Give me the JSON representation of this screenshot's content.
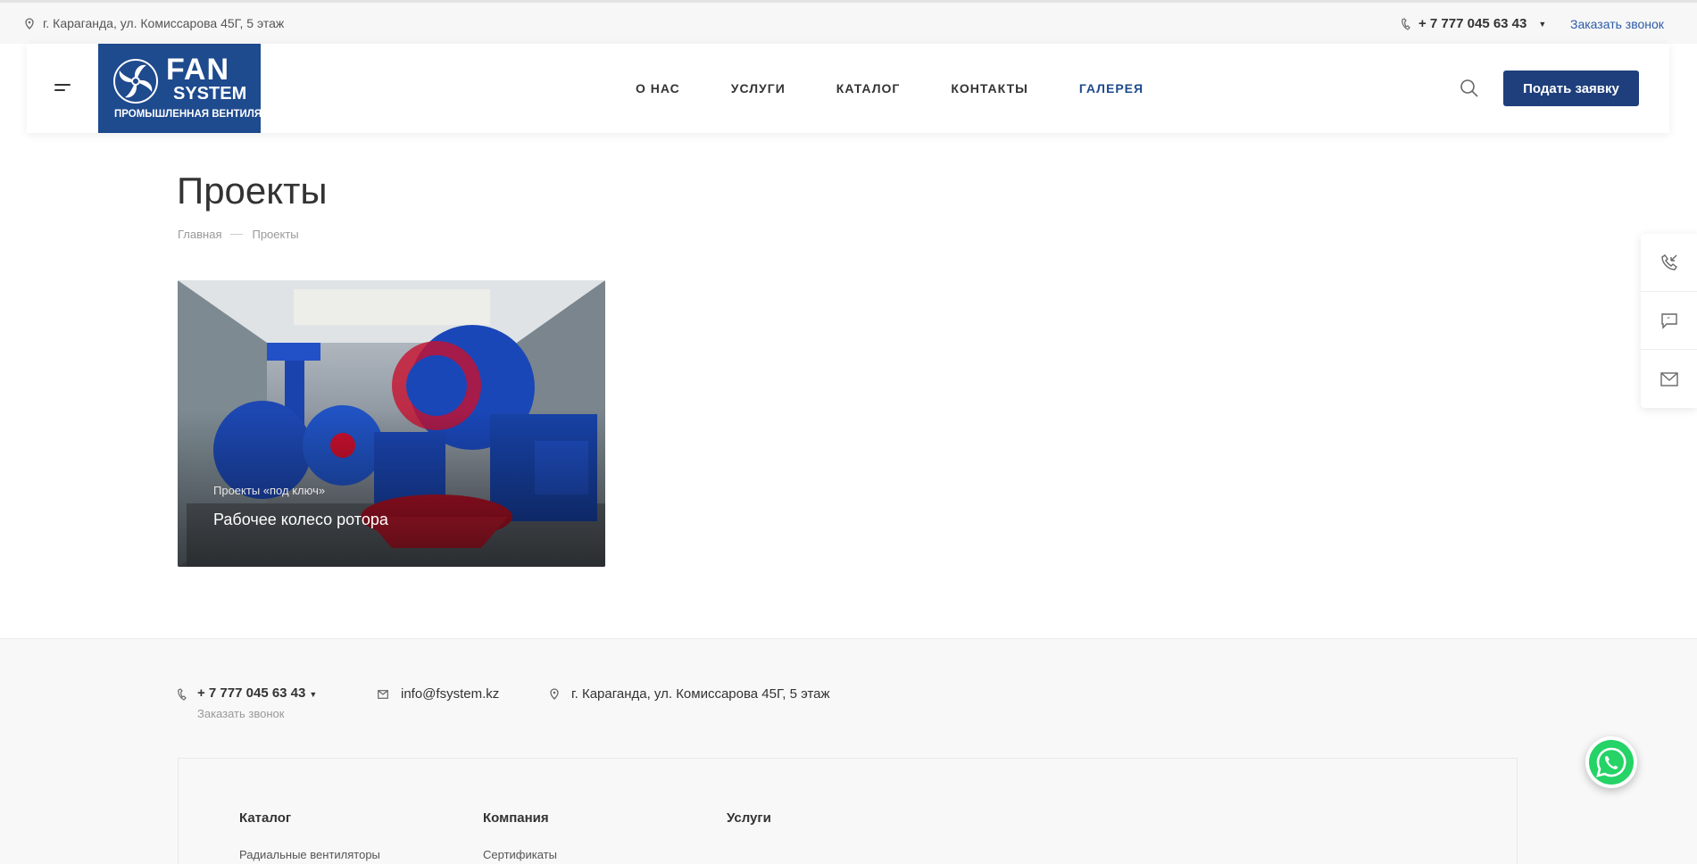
{
  "topbar": {
    "address": "г. Караганда, ул. Комиссарова 45Г, 5 этаж",
    "phone": "+ 7 777 045 63 43",
    "callback": "Заказать звонок"
  },
  "header": {
    "logo": {
      "line1": "FAN",
      "line2": "SYSTEM",
      "line3": "ПРОМЫШЛЕННАЯ ВЕНТИЛЯЦИЯ"
    },
    "nav": [
      "О НАС",
      "УСЛУГИ",
      "КАТАЛОГ",
      "КОНТАКТЫ",
      "ГАЛЕРЕЯ"
    ],
    "active_nav": "ГАЛЕРЕЯ",
    "cta": "Подать заявку"
  },
  "page": {
    "title": "Проекты",
    "breadcrumbs": [
      "Главная",
      "Проекты"
    ]
  },
  "projects": [
    {
      "category": "Проекты «под ключ»",
      "name": "Рабочее колесо ротора"
    }
  ],
  "side_widget": [
    "phone-callback-icon",
    "chat-icon",
    "mail-icon"
  ],
  "footer": {
    "phone": "+ 7 777 045 63 43",
    "callback": "Заказать звонок",
    "email": "info@fsystem.kz",
    "address": "г. Караганда, ул. Комиссарова 45Г, 5 этаж",
    "columns": [
      {
        "title": "Каталог",
        "items": [
          "Радиальные вентиляторы"
        ]
      },
      {
        "title": "Компания",
        "items": [
          "Сертификаты"
        ]
      },
      {
        "title": "Услуги",
        "items": []
      }
    ]
  },
  "colors": {
    "brand": "#1e4a8e",
    "cta": "#1e3f7c",
    "link": "#2d5aa6",
    "whatsapp": "#25d366"
  }
}
